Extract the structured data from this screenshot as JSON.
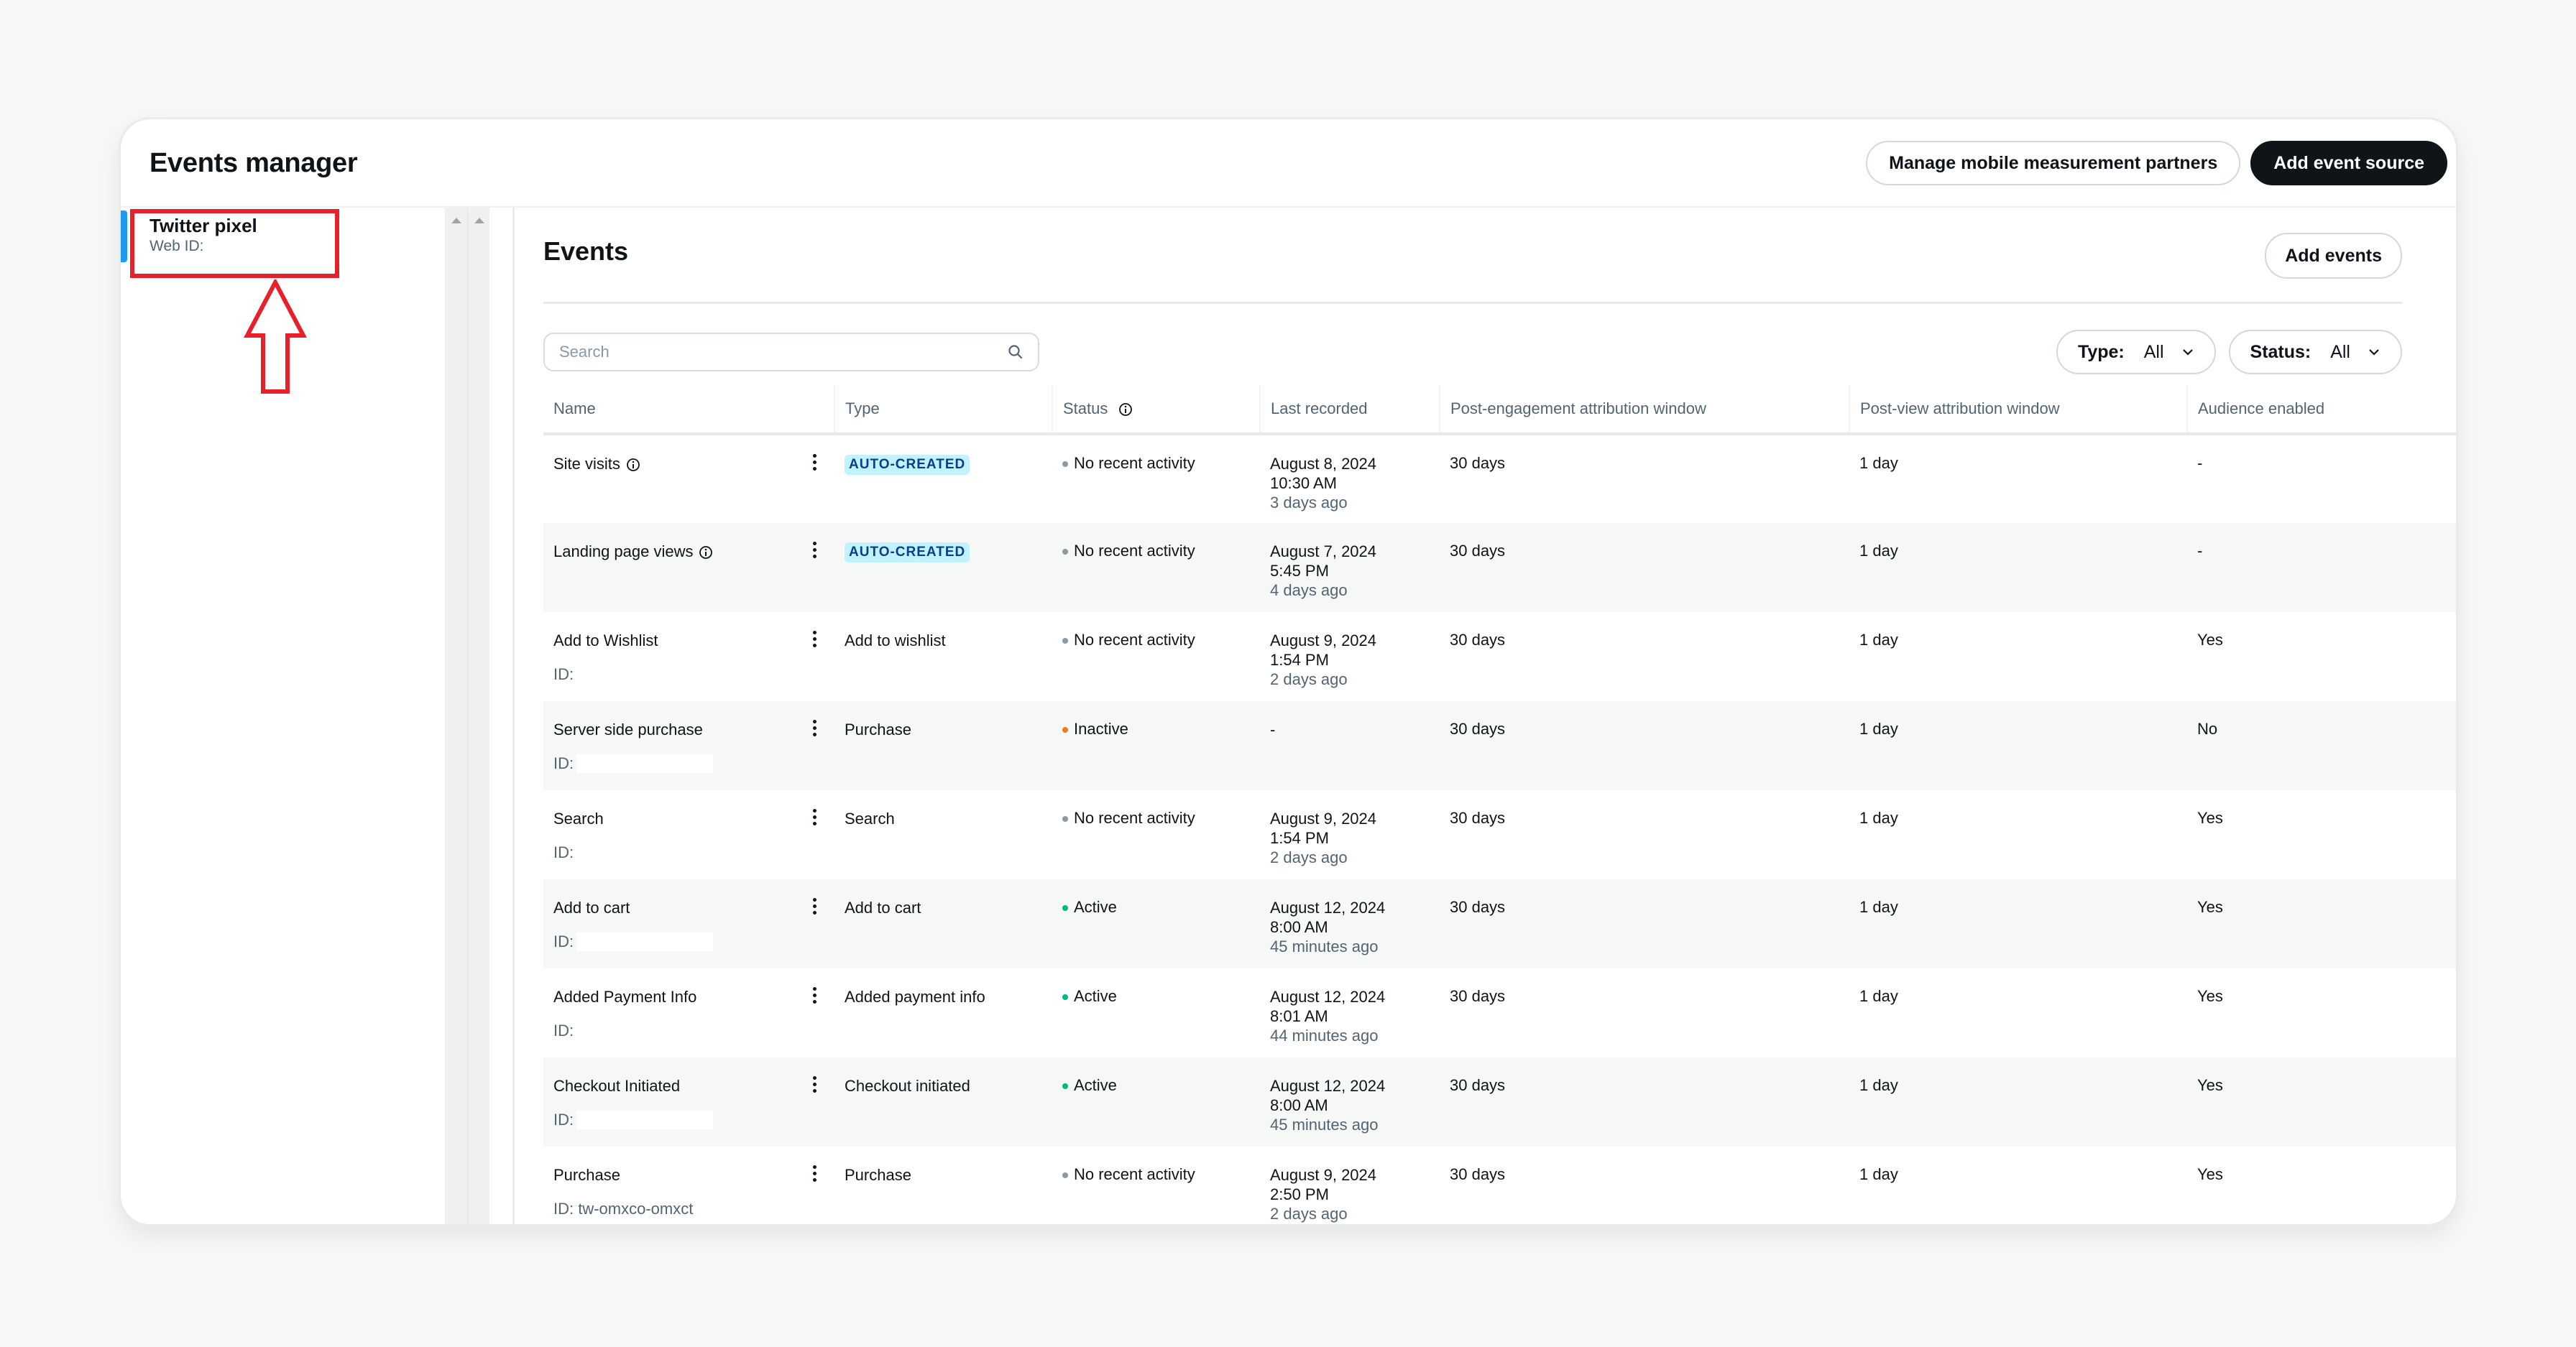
{
  "header": {
    "title": "Events manager",
    "buttons": {
      "manage_partners": "Manage mobile measurement partners",
      "add_source": "Add event source"
    }
  },
  "sidebar": {
    "source": {
      "name": "Twitter pixel",
      "id_label": "Web ID:"
    }
  },
  "annotation": {
    "color": "#e8202a",
    "note": "highlight box with up arrow pointing at Twitter pixel"
  },
  "events": {
    "title": "Events",
    "add_button": "Add events",
    "search": {
      "placeholder": "Search",
      "value": ""
    },
    "filters": {
      "type": {
        "label": "Type:",
        "value": "All"
      },
      "status": {
        "label": "Status:",
        "value": "All"
      }
    },
    "columns": [
      "Name",
      "Type",
      "Status",
      "Last recorded",
      "Post-engagement attribution window",
      "Post-view attribution window",
      "Audience enabled"
    ],
    "status_colors": {
      "No recent activity": "#8b98a5",
      "Inactive": "#f97a12",
      "Active": "#00ba7c"
    },
    "rows": [
      {
        "name": "Site visits",
        "info": true,
        "id": null,
        "type": "AUTO-CREATED",
        "type_badge": true,
        "status": "No recent activity",
        "date": "August 8, 2024",
        "time": "10:30 AM",
        "ago": "3 days ago",
        "post_engagement": "30 days",
        "post_view": "1 day",
        "audience": "-"
      },
      {
        "name": "Landing page views",
        "info": true,
        "id": null,
        "type": "AUTO-CREATED",
        "type_badge": true,
        "status": "No recent activity",
        "date": "August 7, 2024",
        "time": "5:45 PM",
        "ago": "4 days ago",
        "post_engagement": "30 days",
        "post_view": "1 day",
        "audience": "-"
      },
      {
        "name": "Add to Wishlist",
        "info": false,
        "id": "ID:",
        "redacted": false,
        "type": "Add to wishlist",
        "type_badge": false,
        "status": "No recent activity",
        "date": "August 9, 2024",
        "time": "1:54 PM",
        "ago": "2 days ago",
        "post_engagement": "30 days",
        "post_view": "1 day",
        "audience": "Yes"
      },
      {
        "name": "Server side purchase",
        "info": false,
        "id": "ID:",
        "redacted": true,
        "type": "Purchase",
        "type_badge": false,
        "status": "Inactive",
        "date": "-",
        "time": "",
        "ago": "",
        "post_engagement": "30 days",
        "post_view": "1 day",
        "audience": "No"
      },
      {
        "name": "Search",
        "info": false,
        "id": "ID:",
        "redacted": false,
        "type": "Search",
        "type_badge": false,
        "status": "No recent activity",
        "date": "August 9, 2024",
        "time": "1:54 PM",
        "ago": "2 days ago",
        "post_engagement": "30 days",
        "post_view": "1 day",
        "audience": "Yes"
      },
      {
        "name": "Add to cart",
        "info": false,
        "id": "ID:",
        "redacted": true,
        "type": "Add to cart",
        "type_badge": false,
        "status": "Active",
        "date": "August 12, 2024",
        "time": "8:00 AM",
        "ago": "45 minutes ago",
        "post_engagement": "30 days",
        "post_view": "1 day",
        "audience": "Yes"
      },
      {
        "name": "Added Payment Info",
        "info": false,
        "id": "ID:",
        "redacted": false,
        "type": "Added payment info",
        "type_badge": false,
        "status": "Active",
        "date": "August 12, 2024",
        "time": "8:01 AM",
        "ago": "44 minutes ago",
        "post_engagement": "30 days",
        "post_view": "1 day",
        "audience": "Yes"
      },
      {
        "name": "Checkout Initiated",
        "info": false,
        "id": "ID:",
        "redacted": true,
        "type": "Checkout initiated",
        "type_badge": false,
        "status": "Active",
        "date": "August 12, 2024",
        "time": "8:00 AM",
        "ago": "45 minutes ago",
        "post_engagement": "30 days",
        "post_view": "1 day",
        "audience": "Yes"
      },
      {
        "name": "Purchase",
        "info": false,
        "id": "ID: tw-omxco-omxct",
        "redacted": false,
        "type": "Purchase",
        "type_badge": false,
        "status": "No recent activity",
        "date": "August 9, 2024",
        "time": "2:50 PM",
        "ago": "2 days ago",
        "post_engagement": "30 days",
        "post_view": "1 day",
        "audience": "Yes"
      }
    ]
  }
}
